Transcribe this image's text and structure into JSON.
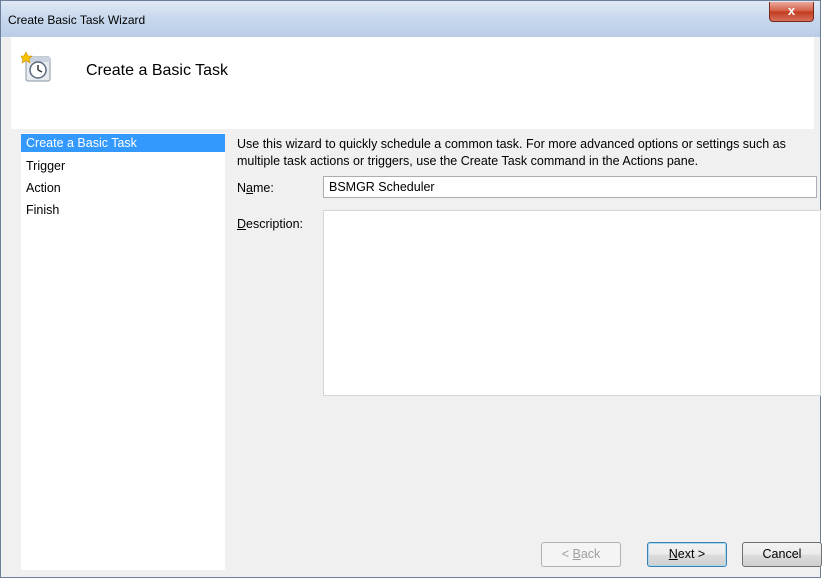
{
  "window": {
    "title": "Create Basic Task Wizard",
    "close_glyph": "x"
  },
  "header": {
    "title": "Create a Basic Task",
    "icon": "scheduled-task-clock-icon"
  },
  "sidebar": {
    "items": [
      {
        "label": "Create a Basic Task",
        "active": true
      },
      {
        "label": "Trigger",
        "active": false
      },
      {
        "label": "Action",
        "active": false
      },
      {
        "label": "Finish",
        "active": false
      }
    ]
  },
  "main": {
    "intro": "Use this wizard to quickly schedule a common task.  For more advanced options or settings such as multiple task actions or triggers, use the Create Task command in the Actions pane.",
    "name_label_pre": "N",
    "name_label_accel": "a",
    "name_label_post": "me:",
    "name_value": "BSMGR Scheduler",
    "description_label_accel": "D",
    "description_label_post": "escription:",
    "description_value": ""
  },
  "buttons": {
    "back_pre": "< ",
    "back_accel": "B",
    "back_post": "ack",
    "next_accel": "N",
    "next_post": "ext >",
    "cancel": "Cancel"
  },
  "colors": {
    "selection": "#3399ff",
    "titlebar": "#c9d9ee",
    "close_button": "#c13a1f"
  }
}
